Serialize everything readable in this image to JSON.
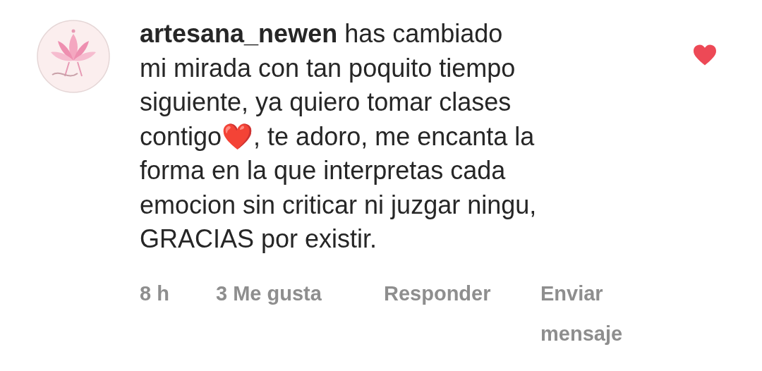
{
  "comment": {
    "text": "**artesana_newen** has cambiado\nmi mirada con tan poquito tiempo\nsiguiente, ya quiero tomar clases\ncontigo❤️, te adoro, me encanta la\nforma en la que interpretas cada\nemocion sin criticar ni juzgar ningu,\nGRACIAS por existir.",
    "time": "8 h",
    "likes": "3 Me gusta",
    "reply": "Responder",
    "send": "Enviar\nmensaje",
    "liked": true
  }
}
